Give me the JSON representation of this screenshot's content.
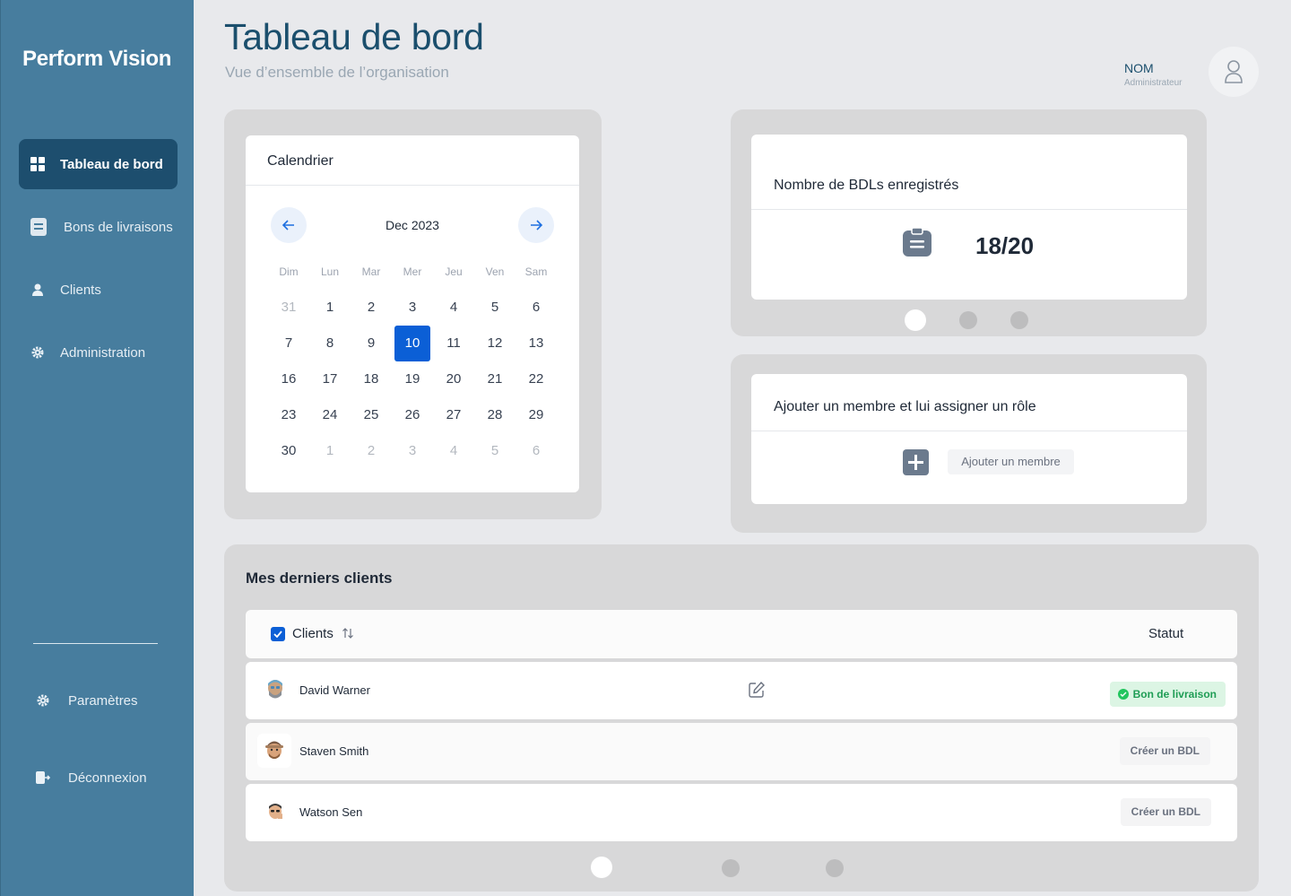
{
  "sidebar": {
    "brand": "Perform Vision",
    "items": [
      {
        "label": "Tableau de bord",
        "icon": "dashboard-icon",
        "active": true
      },
      {
        "label": "Bons de livraisons",
        "icon": "document-icon"
      },
      {
        "label": "Clients",
        "icon": "user-icon"
      },
      {
        "label": "Administration",
        "icon": "gear-icon"
      }
    ],
    "bottom": [
      {
        "label": "Paramètres",
        "icon": "gear-icon"
      },
      {
        "label": "Déconnexion",
        "icon": "logout-icon"
      }
    ]
  },
  "header": {
    "title": "Tableau de bord",
    "subtitle": "Vue d’ensemble de l’organisation",
    "user_name": "NOM",
    "user_role": "Administrateur"
  },
  "calendar": {
    "title": "Calendrier",
    "month": "Dec 2023",
    "weekdays": [
      "Dim",
      "Lun",
      "Mar",
      "Mer",
      "Jeu",
      "Ven",
      "Sam"
    ],
    "selected": "10",
    "weeks": [
      [
        "31",
        "1",
        "2",
        "3",
        "4",
        "5",
        "6"
      ],
      [
        "7",
        "8",
        "9",
        "10",
        "11",
        "12",
        "13"
      ],
      [
        "16",
        "17",
        "18",
        "19",
        "20",
        "21",
        "22"
      ],
      [
        "23",
        "24",
        "25",
        "26",
        "27",
        "28",
        "29"
      ],
      [
        "30",
        "1",
        "2",
        "3",
        "4",
        "5",
        "6"
      ]
    ]
  },
  "bdl_card": {
    "title": "Nombre de BDLs enregistrés",
    "count": "18/20"
  },
  "member_card": {
    "title": "Ajouter un membre et lui assigner un rôle",
    "button": "Ajouter un membre"
  },
  "clients": {
    "title": "Mes derniers clients",
    "col_clients": "Clients",
    "col_status": "Statut",
    "rows": [
      {
        "name": "David Warner",
        "status": "Bon de livraison"
      },
      {
        "name": "Staven Smith",
        "status": "Créer un BDL"
      },
      {
        "name": "Watson Sen",
        "status": "Créer un BDL"
      }
    ]
  },
  "colors": {
    "sidebar": "#477d9e",
    "accent": "#0b5fd6",
    "title": "#1b4f6d",
    "success": "#22c55e"
  }
}
